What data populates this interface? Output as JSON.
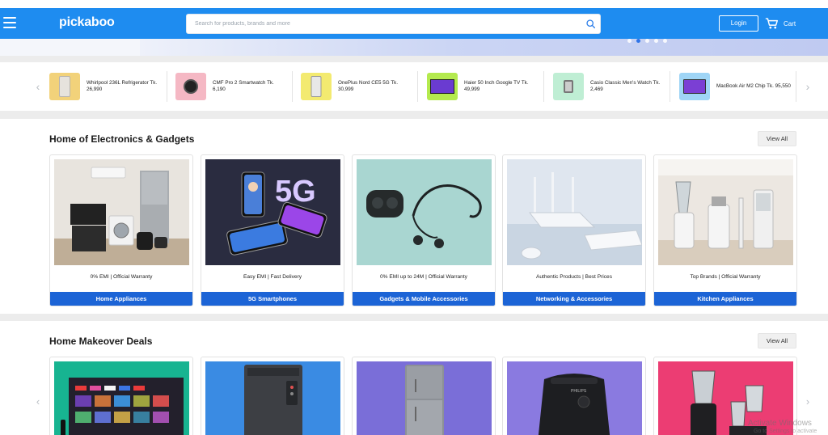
{
  "header": {
    "logo": "pickaboo",
    "search_placeholder": "Search for products, brands and more",
    "login_label": "Login",
    "cart_label": "Cart"
  },
  "banner": {
    "slide_count": 5,
    "active_slide": 2
  },
  "strip": {
    "items": [
      {
        "name": "Whirlpool 236L Refrigerator Tk. 26,990",
        "thumb_bg": "#f2d27a",
        "icon": "refrigerator-icon"
      },
      {
        "name": "CMF Pro 2 Smartwatch Tk. 6,190",
        "thumb_bg": "#f5b8c4",
        "icon": "smartwatch-icon"
      },
      {
        "name": "OnePlus Nord CE5 5G Tk. 30,999",
        "thumb_bg": "#f3ea70",
        "icon": "smartphone-icon"
      },
      {
        "name": "Haier 50 Inch Google TV Tk. 49,999",
        "thumb_bg": "#b4ea4e",
        "icon": "tv-icon"
      },
      {
        "name": "Casio Classic Men's Watch Tk. 2,469",
        "thumb_bg": "#bfeed4",
        "icon": "wristwatch-icon"
      },
      {
        "name": "MacBook Air M2 Chip Tk. 95,550",
        "thumb_bg": "#9fd5f6",
        "icon": "laptop-icon"
      }
    ]
  },
  "sections": [
    {
      "title": "Home of Electronics & Gadgets",
      "view_all": "View All",
      "cards": [
        {
          "note": "0% EMI | Official Warranty",
          "category": "Home Appliances"
        },
        {
          "note": "Easy EMI | Fast Delivery",
          "category": "5G Smartphones"
        },
        {
          "note": "0% EMI up to 24M | Official Warranty",
          "category": "Gadgets & Mobile Accessories"
        },
        {
          "note": "Authentic Products | Best Prices",
          "category": "Networking & Accessories"
        },
        {
          "note": "Top Brands | Official Warranty",
          "category": "Kitchen Appliances"
        }
      ]
    },
    {
      "title": "Home Makeover Deals",
      "view_all": "View All",
      "cards": [
        {
          "image": "smart-tv"
        },
        {
          "image": "washing-machine"
        },
        {
          "image": "refrigerator"
        },
        {
          "image": "air-fryer"
        },
        {
          "image": "blender"
        }
      ]
    }
  ],
  "promo_text": {
    "fiveg": "5G",
    "airfryer_brand": "PHILIPS"
  },
  "watermark": {
    "line1": "Activate Windows",
    "line2": "Go to Settings to activate"
  },
  "colors": {
    "header_blue": "#1e8cf0",
    "category_blue": "#1c64d6",
    "page_bg": "#ececec"
  }
}
